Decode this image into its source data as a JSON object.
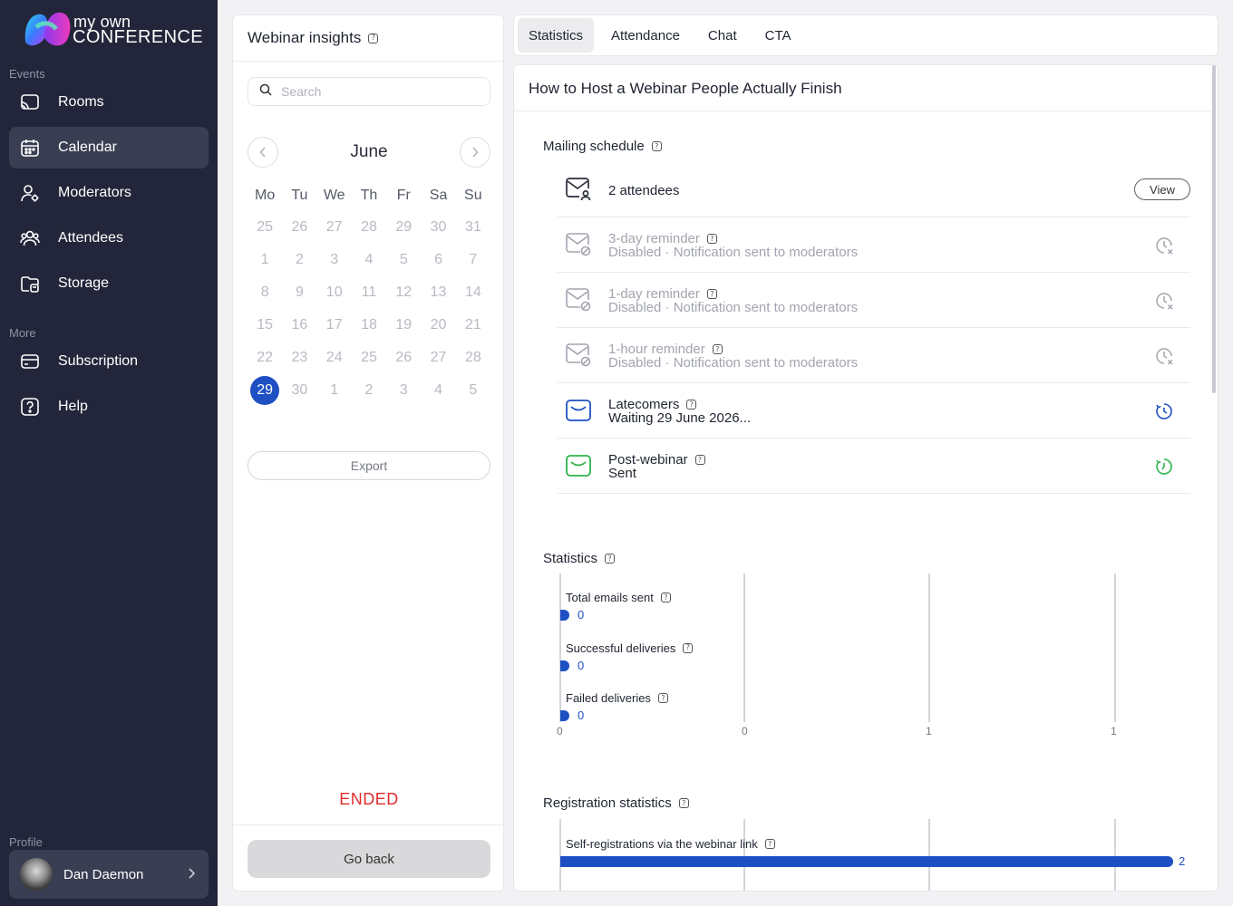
{
  "brand": {
    "line1": "my own",
    "line2": "CONFERENCE"
  },
  "sidebar": {
    "events_label": "Events",
    "events": [
      {
        "label": "Rooms",
        "icon": "cast-icon"
      },
      {
        "label": "Calendar",
        "icon": "calendar-icon",
        "active": true
      },
      {
        "label": "Moderators",
        "icon": "user-gear-icon"
      },
      {
        "label": "Attendees",
        "icon": "users-icon"
      },
      {
        "label": "Storage",
        "icon": "folder-icon"
      }
    ],
    "more_label": "More",
    "more": [
      {
        "label": "Subscription",
        "icon": "credit-card-icon"
      },
      {
        "label": "Help",
        "icon": "help-icon"
      }
    ],
    "profile_label": "Profile",
    "profile_name": "Dan Daemon"
  },
  "insights": {
    "title": "Webinar insights",
    "search_placeholder": "Search",
    "month": "June",
    "weekdays": [
      "Mo",
      "Tu",
      "We",
      "Th",
      "Fr",
      "Sa",
      "Su"
    ],
    "days": [
      "25",
      "26",
      "27",
      "28",
      "29",
      "30",
      "31",
      "1",
      "2",
      "3",
      "4",
      "5",
      "6",
      "7",
      "8",
      "9",
      "10",
      "11",
      "12",
      "13",
      "14",
      "15",
      "16",
      "17",
      "18",
      "19",
      "20",
      "21",
      "22",
      "23",
      "24",
      "25",
      "26",
      "27",
      "28",
      "29",
      "30",
      "1",
      "2",
      "3",
      "4",
      "5"
    ],
    "selected_day_index": 35,
    "export_label": "Export",
    "status": "ENDED",
    "go_back_label": "Go back"
  },
  "tabs": [
    "Statistics",
    "Attendance",
    "Chat",
    "CTA"
  ],
  "active_tab": "Statistics",
  "webinar": {
    "title": "How to Host a Webinar People Actually Finish",
    "mailing_title": "Mailing schedule",
    "attendees": "2 attendees",
    "view_label": "View",
    "mailings": [
      {
        "title": "3-day reminder",
        "sub": "Disabled · Notification sent to moderators",
        "state": "disabled"
      },
      {
        "title": "1-day reminder",
        "sub": "Disabled · Notification sent to moderators",
        "state": "disabled"
      },
      {
        "title": "1-hour reminder",
        "sub": "Disabled · Notification sent to moderators",
        "state": "disabled"
      },
      {
        "title": "Latecomers",
        "sub": "Waiting 29 June 2026...",
        "state": "waiting"
      },
      {
        "title": "Post-webinar",
        "sub": "Sent",
        "state": "sent"
      }
    ],
    "statistics_title": "Statistics",
    "stats": [
      {
        "label": "Total emails sent",
        "value": "0"
      },
      {
        "label": "Successful deliveries",
        "value": "0"
      },
      {
        "label": "Failed deliveries",
        "value": "0"
      }
    ],
    "stat_ticks": [
      "0",
      "0",
      "1",
      "1"
    ],
    "registration_title": "Registration statistics",
    "registration": [
      {
        "label": "Self-registrations via the webinar link",
        "value": "2"
      }
    ]
  },
  "colors": {
    "accent": "#1e50c3",
    "sent": "#2eb34a",
    "ended": "#e02c2c",
    "sidebar": "#23263a"
  }
}
